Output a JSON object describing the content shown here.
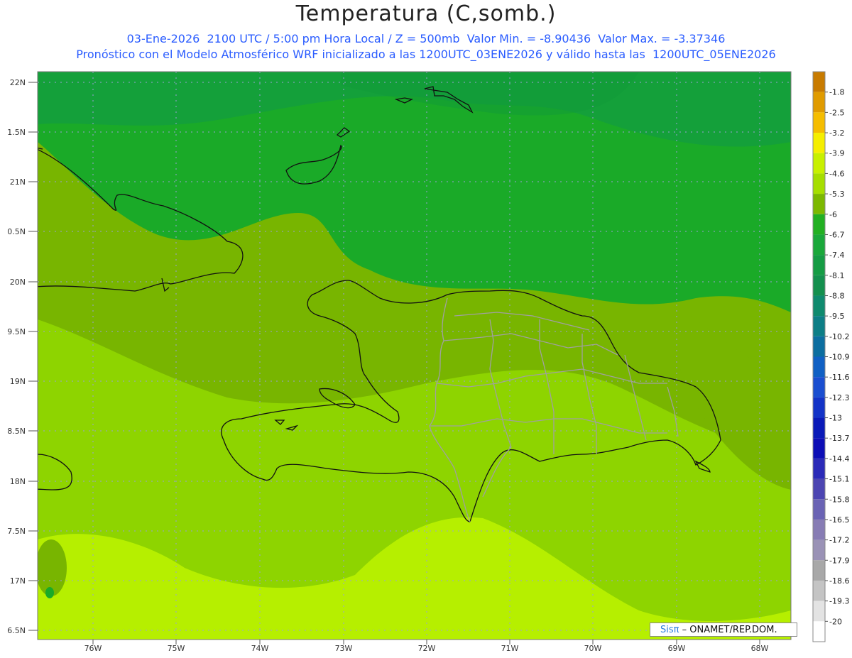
{
  "title": "Temperatura (C,somb.)",
  "subtitle_line1": "03-Ene-2026  2100 UTC / 5:00 pm Hora Local / Z = 500mb  Valor Min. = -8.90436  Valor Max. = -3.37346",
  "subtitle_line2": "Pronóstico con el Modelo Atmosférico WRF inicializado a las 1200UTC_03ENE2026 y válido hasta las  1200UTC_05ENE2026",
  "credit": {
    "brand": "Sisπ",
    "text": "– ONAMET/REP.DOM."
  },
  "lat_labels": [
    "22N",
    "1.5N",
    "21N",
    "0.5N",
    "20N",
    "9.5N",
    "19N",
    "8.5N",
    "18N",
    "7.5N",
    "17N",
    "6.5N"
  ],
  "lon_labels": [
    "76W",
    "75W",
    "74W",
    "73W",
    "72W",
    "71W",
    "70W",
    "69W",
    "68W"
  ],
  "legend": {
    "labels": [
      "-1.8",
      "-2.5",
      "-3.2",
      "-3.9",
      "-4.6",
      "-5.3",
      "-6",
      "-6.7",
      "-7.4",
      "-8.1",
      "-8.8",
      "-9.5",
      "-10.2",
      "-10.9",
      "-11.6",
      "-12.3",
      "-13",
      "-13.7",
      "-14.4",
      "-15.1",
      "-15.8",
      "-16.5",
      "-17.2",
      "-17.9",
      "-18.6",
      "-19.3",
      "-20"
    ],
    "colors": [
      "#c87b00",
      "#e09b00",
      "#f5bd00",
      "#f5ee00",
      "#c8f000",
      "#a6de00",
      "#7cb800",
      "#22b022",
      "#1aa83a",
      "#159c44",
      "#14904e",
      "#0f8a6e",
      "#0d7e86",
      "#0c6ea0",
      "#1060c4",
      "#1a4ed0",
      "#1333c7",
      "#0a1ab8",
      "#0d0eb6",
      "#2b2ab8",
      "#4c45b2",
      "#6a63b4",
      "#877cb4",
      "#9a92b6",
      "#a8a8a8",
      "#c4c4c4",
      "#e3e3e3",
      "#ffffff"
    ]
  },
  "map": {
    "colors": {
      "deep_green": "#14a03a",
      "green": "#1aaa28",
      "olive": "#78b500",
      "lime": "#8ed400",
      "yellow_lime": "#b6ef00",
      "border": "#111111",
      "provinces": "#a0a0a0"
    }
  }
}
